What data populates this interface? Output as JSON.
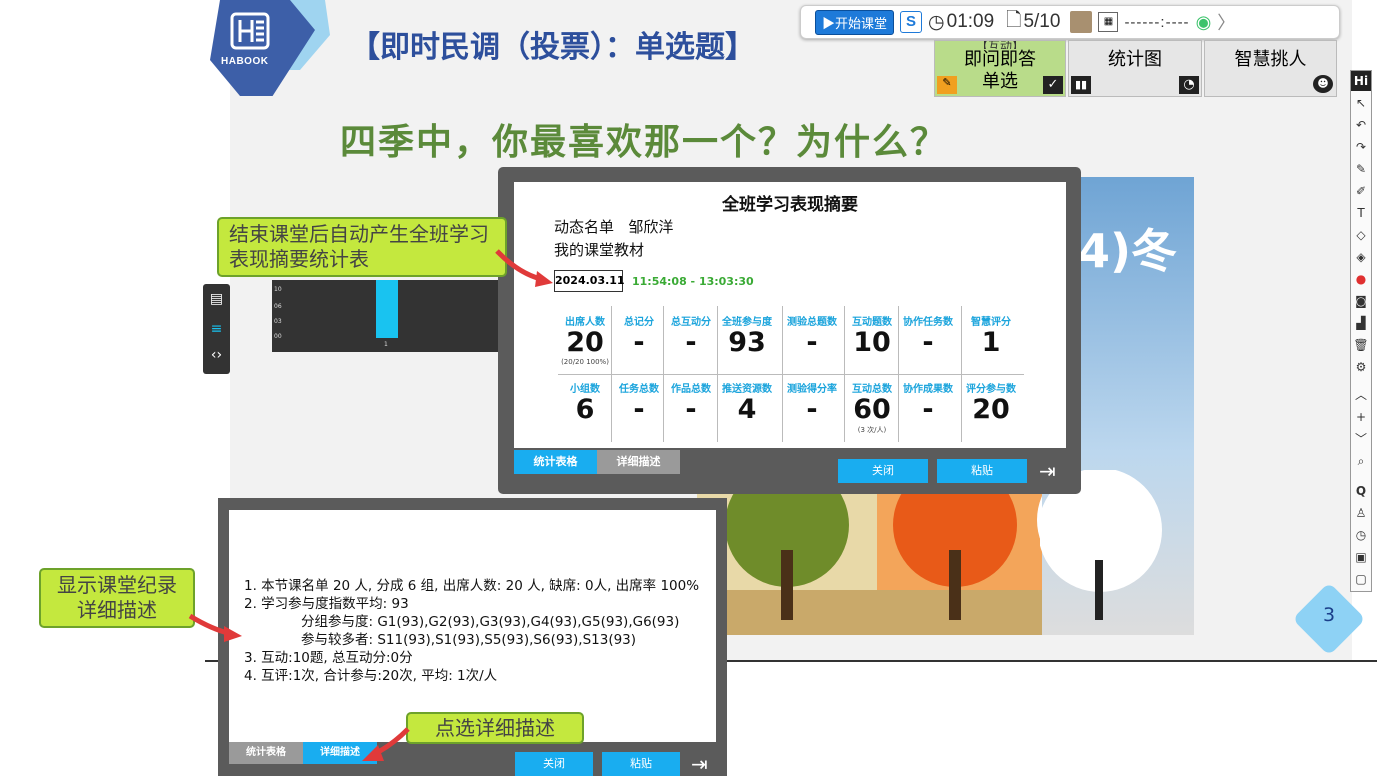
{
  "slide": {
    "logo_text": "HABOOK",
    "title": "【即时民调（投票）：单选题】",
    "question": "四季中，你最喜欢那一个？为什么？",
    "winter_label": "4)冬",
    "page_number": "3"
  },
  "toolbar": {
    "start_label": "开始课堂",
    "timer": "01:09",
    "page_count": "5/10",
    "status": "------:----"
  },
  "tabs": {
    "quick_answer_top": "【互动】",
    "quick_answer": "即问即答",
    "single_choice": "单选",
    "stat_chart": "统计图",
    "smart_pick": "智慧挑人"
  },
  "bg_chart": {
    "ticks": [
      "10",
      "06",
      "03",
      "00"
    ],
    "category": "1"
  },
  "summary": {
    "title": "全班学习表现摘要",
    "roster_label": "动态名单",
    "roster_name": "邹欣洋",
    "material": "我的课堂教材",
    "date": "2024.03.11",
    "time_range": "11:54:08  -  13:03:30",
    "row1": [
      {
        "label": "出席人数",
        "value": "20",
        "sub": "(20/20 100%)"
      },
      {
        "label": "总记分",
        "value": "-",
        "sub": ""
      },
      {
        "label": "总互动分",
        "value": "-",
        "sub": ""
      },
      {
        "label": "全班参与度",
        "value": "93",
        "sub": ""
      },
      {
        "label": "测验总题数",
        "value": "-",
        "sub": ""
      },
      {
        "label": "互动题数",
        "value": "10",
        "sub": ""
      },
      {
        "label": "协作任务数",
        "value": "-",
        "sub": ""
      },
      {
        "label": "智慧评分",
        "value": "1",
        "sub": ""
      }
    ],
    "row2": [
      {
        "label": "小组数",
        "value": "6",
        "sub": ""
      },
      {
        "label": "任务总数",
        "value": "-",
        "sub": ""
      },
      {
        "label": "作品总数",
        "value": "-",
        "sub": ""
      },
      {
        "label": "推送资源数",
        "value": "4",
        "sub": ""
      },
      {
        "label": "测验得分率",
        "value": "-",
        "sub": ""
      },
      {
        "label": "互动总数",
        "value": "60",
        "sub": "(3 次/人)"
      },
      {
        "label": "协作成果数",
        "value": "-",
        "sub": ""
      },
      {
        "label": "评分参与数",
        "value": "20",
        "sub": ""
      }
    ],
    "tab_table": "统计表格",
    "tab_detail": "详细描述",
    "close": "关闭",
    "paste": "粘贴"
  },
  "detail": {
    "lines": [
      "1. 本节课名单 20 人, 分成 6 组, 出席人数: 20 人, 缺席: 0人, 出席率 100%",
      "2. 学习参与度指数平均: 93",
      "分组参与度: G1(93),G2(93),G3(93),G4(93),G5(93),G6(93)",
      "参与较多者: S11(93),S1(93),S5(93),S6(93),S13(93)",
      "3. 互动:10题, 总互动分:0分",
      "4. 互评:1次, 合计参与:20次, 平均: 1次/人"
    ],
    "tab_table": "统计表格",
    "tab_detail": "详细描述",
    "close": "关闭",
    "paste": "粘贴"
  },
  "callouts": {
    "auto_summary": "结束课堂后自动产生全班学习表现摘要统计表",
    "show_detail": "显示课堂纪录详细描述",
    "click_detail": "点选详细描述"
  },
  "right_tools": {
    "hi": "Hi",
    "q": "Q"
  },
  "colors": {
    "accent_blue": "#19adf0",
    "callout_green": "#c4e83e",
    "tab_active": "#b9dc8a",
    "label_blue": "#1ba4dc"
  }
}
